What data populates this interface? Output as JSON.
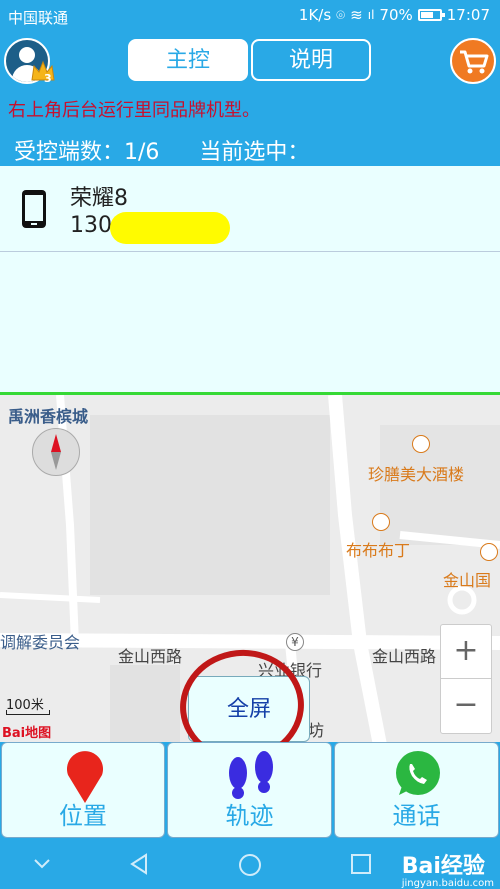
{
  "status_bar": {
    "carrier": "中国联通",
    "speed": "1K/s",
    "battery": "70%",
    "battery_level": 0.7,
    "time": "17:07"
  },
  "header": {
    "level": "3",
    "tab_main": "主控",
    "tab_help": "说明",
    "accent": "#29a9e6",
    "cart_color": "#f07a22"
  },
  "info": {
    "notice": "右上角后台运行里同品牌机型。",
    "controlled_label": "受控端数：1/6",
    "selected_label": "当前选中："
  },
  "devices": [
    {
      "name": "荣耀8",
      "number": "130"
    }
  ],
  "map": {
    "labels": {
      "place_1": "禹洲香槟城",
      "poi_1": "珍膳美大酒楼",
      "poi_2": "布布布丁",
      "poi_3": "金山国",
      "place_2": "调解委员会",
      "road_1": "金山西路",
      "bank": "兴业银行",
      "road_2": "金山西路",
      "road_3": "坊"
    },
    "scale": "100米",
    "baidu": "Bai地图",
    "fullscreen": "全屏"
  },
  "bottom": {
    "location": "位置",
    "track": "轨迹",
    "call": "通话"
  },
  "watermark": {
    "main": "Bai经验",
    "sub": "jingyan.baidu.com"
  }
}
